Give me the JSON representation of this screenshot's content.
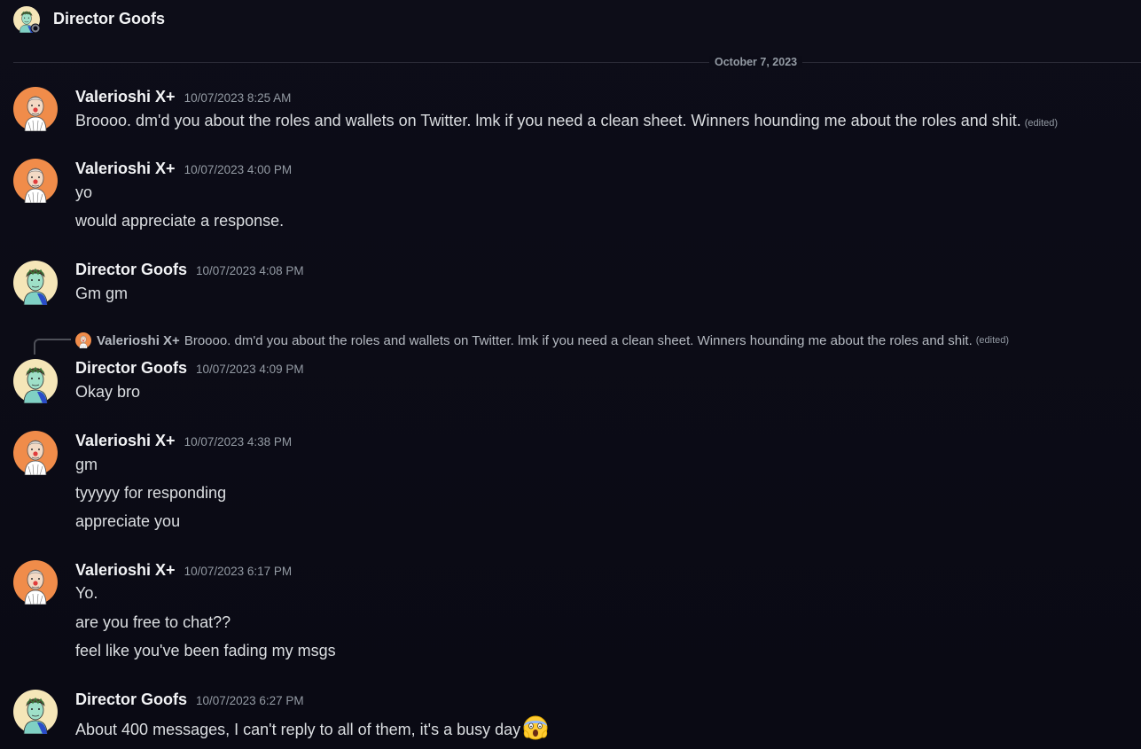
{
  "header": {
    "title": "Director Goofs"
  },
  "divider": {
    "date": "October 7, 2023"
  },
  "reply": {
    "author": "Valerioshi X+",
    "text": "Broooo. dm'd you about the roles and wallets on Twitter. lmk if you need a clean sheet. Winners hounding me about the roles and shit.",
    "edited": "(edited)"
  },
  "messages": [
    {
      "author": "Valerioshi X+",
      "timestamp": "10/07/2023 8:25 AM",
      "lines": [
        "Broooo. dm'd you about the roles and wallets on Twitter. lmk if you need a clean sheet. Winners hounding me about the roles and shit."
      ],
      "edited": "(edited)"
    },
    {
      "author": "Valerioshi X+",
      "timestamp": "10/07/2023 4:00 PM",
      "lines": [
        "yo",
        "would appreciate a response."
      ]
    },
    {
      "author": "Director Goofs",
      "timestamp": "10/07/2023 4:08 PM",
      "lines": [
        "Gm gm"
      ]
    },
    {
      "author": "Director Goofs",
      "timestamp": "10/07/2023 4:09 PM",
      "lines": [
        "Okay bro"
      ]
    },
    {
      "author": "Valerioshi X+",
      "timestamp": "10/07/2023 4:38 PM",
      "lines": [
        "gm",
        "tyyyyy for responding",
        "appreciate you"
      ]
    },
    {
      "author": "Valerioshi X+",
      "timestamp": "10/07/2023 6:17 PM",
      "lines": [
        "Yo.",
        "are you free to chat??",
        "feel like you've been fading my msgs"
      ]
    },
    {
      "author": "Director Goofs",
      "timestamp": "10/07/2023 6:27 PM",
      "lines": [
        "About 400 messages, I can't reply to all of them, it's a busy day"
      ],
      "emoji": "scream-emoji"
    }
  ],
  "colors": {
    "background": "#0b0b16",
    "author": "#f2f3f5",
    "text": "#dbdee1",
    "muted": "#949ba4",
    "valerioshi_avatar_bg": "#f08c4a",
    "goofs_avatar_bg": "#f5e6b8"
  },
  "icons": {
    "header_avatar": "director-goofs-avatar",
    "status": "offline-status-icon"
  }
}
